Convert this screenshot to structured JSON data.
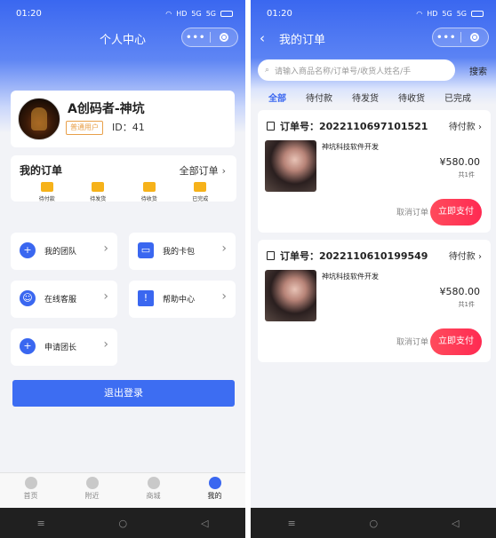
{
  "left": {
    "status": {
      "time": "01:20",
      "net": "HD",
      "signal_1": "5G",
      "signal_2": "5G"
    },
    "nav": {
      "title": "个人中心",
      "more": "•••"
    },
    "profile": {
      "name": "A创码者-神坑",
      "role": "普通用户",
      "id_text": "ID：41"
    },
    "orders": {
      "title": "我的订单",
      "view_all": "全部订单",
      "tabs": [
        {
          "label": "待付款",
          "icon": "wallet-icon"
        },
        {
          "label": "待发货",
          "icon": "box-icon"
        },
        {
          "label": "待收货",
          "icon": "truck-icon"
        },
        {
          "label": "已完成",
          "icon": "check-icon"
        }
      ]
    },
    "menu": [
      {
        "label": "我的团队",
        "icon": "team-icon",
        "glyph": "+"
      },
      {
        "label": "我的卡包",
        "icon": "card-icon",
        "glyph": "▭"
      },
      {
        "label": "在线客服",
        "icon": "service-icon",
        "glyph": "☺"
      },
      {
        "label": "帮助中心",
        "icon": "warning-icon",
        "glyph": "!"
      },
      {
        "label": "申请团长",
        "icon": "plus-circle-icon",
        "glyph": "+"
      }
    ],
    "logout": "退出登录",
    "tabbar": [
      {
        "label": "首页",
        "icon": "home-icon"
      },
      {
        "label": "附近",
        "icon": "location-icon"
      },
      {
        "label": "商城",
        "icon": "store-icon"
      },
      {
        "label": "我的",
        "icon": "profile-icon"
      }
    ],
    "sysnav": [
      "≡",
      "○",
      "◁"
    ]
  },
  "right": {
    "status": {
      "time": "01:20",
      "net": "HD",
      "signal_1": "5G",
      "signal_2": "5G"
    },
    "nav": {
      "back": "‹",
      "title": "我的订单",
      "more": "•••"
    },
    "search": {
      "placeholder": "请输入商品名称/订单号/收货人姓名/手",
      "button": "搜索"
    },
    "tabs": [
      "全部",
      "待付款",
      "待发货",
      "待收货",
      "已完成"
    ],
    "active_tab": "全部",
    "orders": [
      {
        "order_no": "订单号：2022110697101521",
        "status": "待付款",
        "shop": "神坑科技软件开发",
        "price": "¥580.00",
        "qty": "共1件",
        "cancel": "取消订单",
        "pay": "立即支付"
      },
      {
        "order_no": "订单号：2022110610199549",
        "status": "待付款",
        "shop": "神坑科技软件开发",
        "price": "¥580.00",
        "qty": "共1件",
        "cancel": "取消订单",
        "pay": "立即支付"
      }
    ],
    "sysnav": [
      "≡",
      "○",
      "◁"
    ]
  },
  "colors": {
    "primary": "#3a67f0",
    "accent": "#f6b21a",
    "pay": "#ff2a52",
    "badge": "#e8a04a"
  }
}
